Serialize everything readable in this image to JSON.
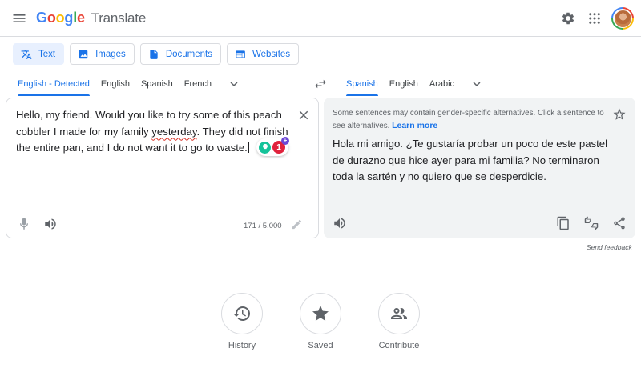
{
  "header": {
    "logo_letters": [
      "G",
      "o",
      "o",
      "g",
      "l",
      "e"
    ],
    "product_name": "Translate"
  },
  "modes": [
    {
      "label": "Text",
      "icon": "translate-icon",
      "active": true
    },
    {
      "label": "Images",
      "icon": "image-icon",
      "active": false
    },
    {
      "label": "Documents",
      "icon": "document-icon",
      "active": false
    },
    {
      "label": "Websites",
      "icon": "website-icon",
      "active": false
    }
  ],
  "source_languages": [
    "English - Detected",
    "English",
    "Spanish",
    "French"
  ],
  "target_languages": [
    "Spanish",
    "English",
    "Arabic"
  ],
  "source": {
    "text_part1": "Hello, my friend. Would you like to try some of this peach cobbler I made for my family ",
    "text_misspelled": "yesterday",
    "text_part2": ". They did not finish the entire pan, and I do not want it to go to waste.",
    "char_count": "171 / 5,000",
    "grammar_issue_count": "1"
  },
  "target": {
    "notice": "Some sentences may contain gender-specific alternatives. Click a sentence to see alternatives.",
    "learn_more": "Learn more",
    "text": "Hola mi amigo. ¿Te gustaría probar un poco de este pastel de durazno que hice ayer para mi familia? No terminaron toda la sartén y no quiero que se desperdicie."
  },
  "send_feedback": "Send feedback",
  "bottom_actions": [
    {
      "label": "History",
      "icon": "history-icon"
    },
    {
      "label": "Saved",
      "icon": "star-icon"
    },
    {
      "label": "Contribute",
      "icon": "people-icon"
    }
  ],
  "colors": {
    "accent": "#1a73e8",
    "logo": [
      "#4285f4",
      "#ea4335",
      "#fbbc05",
      "#4285f4",
      "#34a853",
      "#ea4335"
    ]
  }
}
